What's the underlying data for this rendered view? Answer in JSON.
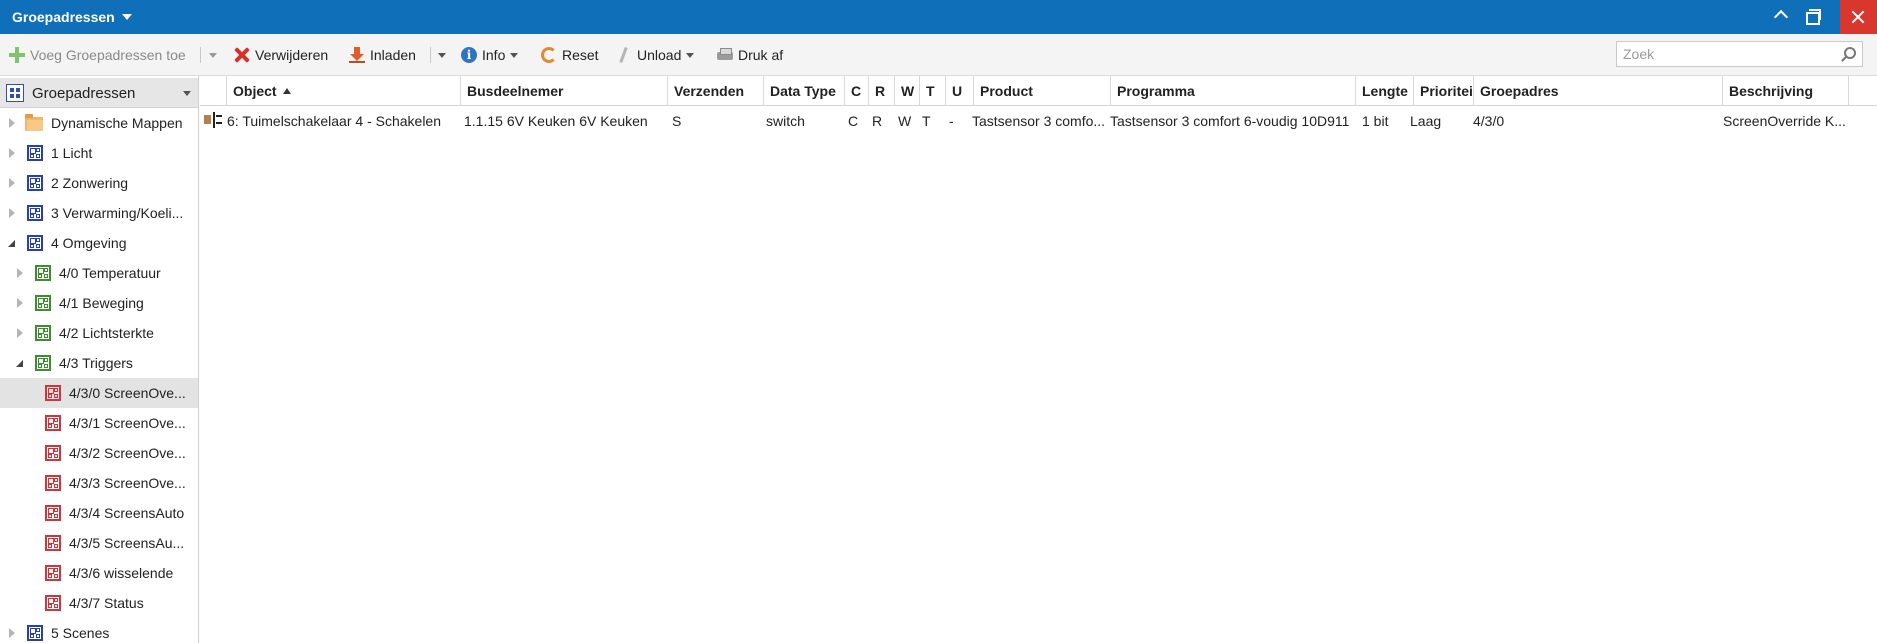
{
  "window": {
    "title": "Groepadressen"
  },
  "toolbar": {
    "add_label": "Voeg Groepadressen toe",
    "delete_label": "Verwijderen",
    "load_label": "Inladen",
    "info_label": "Info",
    "reset_label": "Reset",
    "unload_label": "Unload",
    "print_label": "Druk af",
    "search_placeholder": "Zoek"
  },
  "tree": {
    "header": "Groepadressen",
    "items": [
      {
        "label": "Dynamische Mappen"
      },
      {
        "label": "1 Licht"
      },
      {
        "label": "2 Zonwering"
      },
      {
        "label": "3 Verwarming/Koeli..."
      },
      {
        "label": "4 Omgeving"
      },
      {
        "label": "4/0 Temperatuur"
      },
      {
        "label": "4/1 Beweging"
      },
      {
        "label": "4/2 Lichtsterkte"
      },
      {
        "label": "4/3 Triggers"
      },
      {
        "label": "4/3/0 ScreenOve..."
      },
      {
        "label": "4/3/1 ScreenOve..."
      },
      {
        "label": "4/3/2 ScreenOve..."
      },
      {
        "label": "4/3/3 ScreenOve..."
      },
      {
        "label": "4/3/4 ScreensAuto"
      },
      {
        "label": "4/3/5 ScreensAu..."
      },
      {
        "label": "4/3/6 wisselende"
      },
      {
        "label": "4/3/7 Status"
      },
      {
        "label": "5 Scenes"
      }
    ]
  },
  "grid": {
    "columns": [
      "Object",
      "Busdeelnemer",
      "Verzenden",
      "Data Type",
      "C",
      "R",
      "W",
      "T",
      "U",
      "Product",
      "Programma",
      "Lengte",
      "Prioritei",
      "Groepadres",
      "Beschrijving"
    ],
    "rows": [
      {
        "object": "6: Tuimelschakelaar 4 - Schakelen",
        "busdeelnemer": "1.1.15 6V Keuken 6V Keuken",
        "verzenden": "S",
        "data_type": "switch",
        "c": "C",
        "r": "R",
        "w": "W",
        "t": "T",
        "u": "-",
        "product": "Tastsensor 3 comfo...",
        "programma": "Tastsensor 3 comfort 6-voudig 10D911",
        "lengte": "1 bit",
        "prioriteit": "Laag",
        "groepadres": "4/3/0",
        "beschrijving": "ScreenOverride K..."
      }
    ]
  }
}
